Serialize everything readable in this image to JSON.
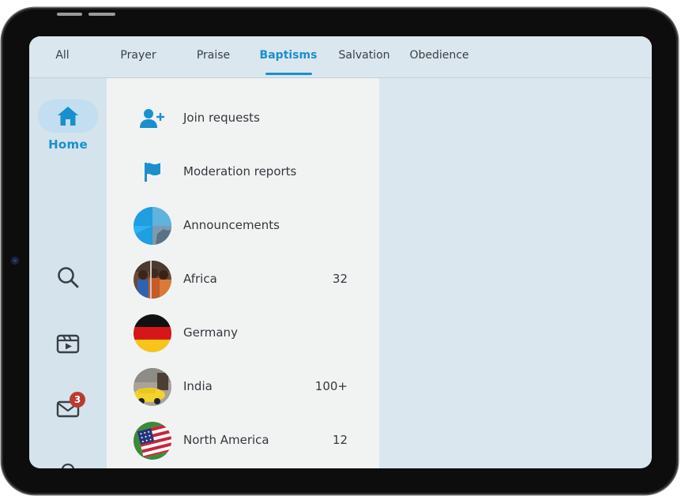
{
  "tabs": [
    {
      "label": "All",
      "active": false
    },
    {
      "label": "Prayer",
      "active": false
    },
    {
      "label": "Praise",
      "active": false
    },
    {
      "label": "Baptisms",
      "active": true
    },
    {
      "label": "Salvation",
      "active": false
    },
    {
      "label": "Obedience",
      "active": false
    }
  ],
  "rail": {
    "home_label": "Home",
    "icons": [
      "home-icon",
      "search-icon",
      "video-icon",
      "mail-icon",
      "bell-icon"
    ],
    "mail_badge": "3"
  },
  "panel": {
    "join_requests": "Join requests",
    "moderation_reports": "Moderation reports",
    "groups": [
      {
        "name": "Announcements",
        "count": ""
      },
      {
        "name": "Africa",
        "count": "32"
      },
      {
        "name": "Germany",
        "count": ""
      },
      {
        "name": "India",
        "count": "100+"
      },
      {
        "name": "North America",
        "count": "12"
      }
    ]
  },
  "colors": {
    "accent": "#1a8fce",
    "background": "#dae7ee",
    "panel": "#f1f3f3",
    "badge": "#b93a32"
  }
}
